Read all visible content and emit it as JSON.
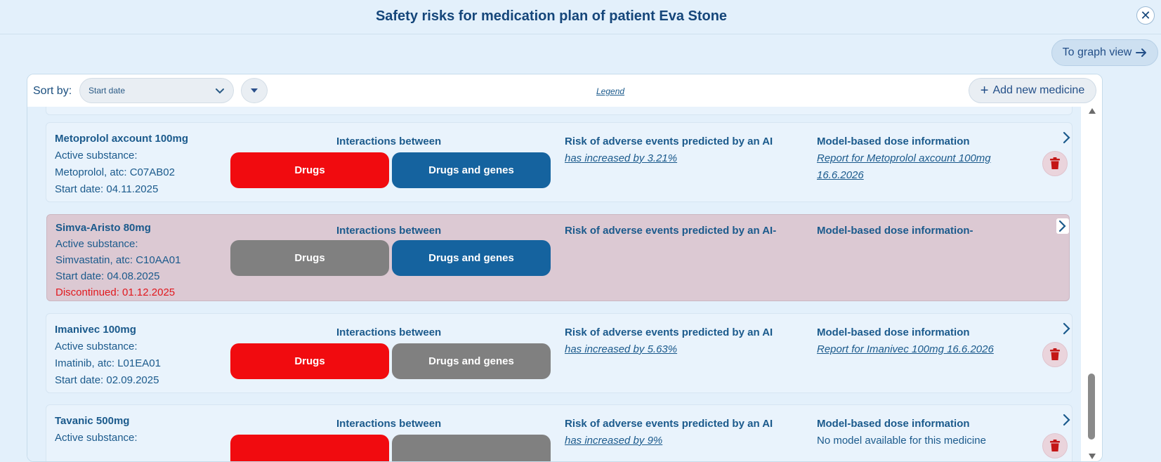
{
  "header": {
    "title": "Safety risks for medication plan of patient Eva Stone",
    "close_label": "✕"
  },
  "graph_view_button": {
    "label": "To graph view",
    "icon": "arrow-right-icon"
  },
  "toolbar": {
    "sort_label": "Sort by:",
    "sort_value": "Start date",
    "legend_label": "Legend",
    "add_label": "Add new medicine"
  },
  "medicines": [
    {
      "name": "Metoprolol axcount 100mg",
      "active_label": "Active substance:",
      "substance": "Metoprolol, atc: C07AB02",
      "start": "Start date: 04.11.2025",
      "interactions_title": "Interactions between",
      "drugs_label": "Drugs",
      "genes_label": "Drugs and genes",
      "drugs_color": "#f10b0f",
      "genes_color": "#15639f",
      "risk_title": "Risk of adverse events predicted by an AI",
      "risk_value": "has increased by 3.21%",
      "dose_title": "Model-based dose information",
      "dose_line1": "Report for Metoprolol axcount 100mg",
      "dose_line2": "16.6.2026"
    },
    {
      "name": "Simva-Aristo 80mg",
      "active_label": "Active substance:",
      "substance": "Simvastatin, atc: C10AA01",
      "start": "Start date: 04.08.2025",
      "discontinued": "Discontinued: 01.12.2025",
      "interactions_title": "Interactions between",
      "drugs_label": "Drugs",
      "genes_label": "Drugs and genes",
      "drugs_color": "#808080",
      "genes_color": "#15639f",
      "risk_title": "Risk of adverse events predicted by an AI-",
      "dose_title": "Model-based dose information-"
    },
    {
      "name": "Imanivec 100mg",
      "active_label": "Active substance:",
      "substance": "Imatinib, atc: L01EA01",
      "start": "Start date: 02.09.2025",
      "interactions_title": "Interactions between",
      "drugs_label": "Drugs",
      "genes_label": "Drugs and genes",
      "drugs_color": "#f10b0f",
      "genes_color": "#808080",
      "risk_title": "Risk of adverse events predicted by an AI",
      "risk_value": "has increased by 5.63%",
      "dose_title": "Model-based dose information",
      "dose_line1": "Report for Imanivec 100mg 16.6.2026"
    },
    {
      "name": "Tavanic 500mg",
      "active_label": "Active substance:",
      "interactions_title": "Interactions between",
      "drugs_color": "#f10b0f",
      "genes_color": "#808080",
      "risk_title": "Risk of adverse events predicted by an AI",
      "risk_value": "has increased by 9%",
      "dose_title": "Model-based dose information",
      "dose_line1": "No model available for this medicine"
    }
  ],
  "colors": {
    "background": "#e3f0fb",
    "title": "#15467a",
    "text": "#1b5a8c",
    "alert": "#e1181e"
  }
}
